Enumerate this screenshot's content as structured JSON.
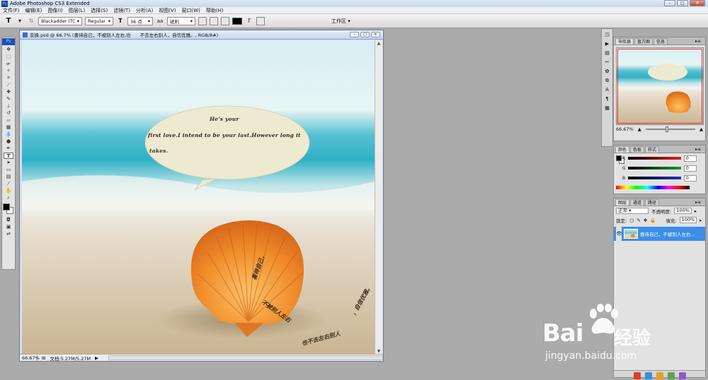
{
  "app": {
    "title": "Adobe Photoshop CS3 Extended",
    "logo": "Ps"
  },
  "menu": [
    "文件(F)",
    "编辑(E)",
    "图像(I)",
    "图层(L)",
    "选择(S)",
    "滤镜(T)",
    "分析(A)",
    "视图(V)",
    "窗口(W)",
    "帮助(H)"
  ],
  "options": {
    "tool_icon": "T",
    "font_family": "Blackadder ITC",
    "font_style": "Regular",
    "font_size": "36 点",
    "antialias": "锐利",
    "workspace": "工作区"
  },
  "document": {
    "title": "变换.psd @ 66.7% (喜待自己，不被别人左右,也　　不去左右别人，自信优雅。, RGB/8#)",
    "zoom": "66.67%",
    "doc_size": "文档:5.27M/5.27M",
    "bubble_lines": [
      "He's your",
      "first love.I intend to be your last.However long it",
      "takes."
    ]
  },
  "navigator": {
    "tabs": [
      "导航器",
      "直方图",
      "信息"
    ],
    "zoom": "66.67%"
  },
  "color_panel": {
    "tabs": [
      "颜色",
      "色板",
      "样式"
    ],
    "channels": [
      {
        "label": "R",
        "value": "0",
        "color": "#e02020"
      },
      {
        "label": "G",
        "value": "0",
        "color": "#1a9a2a"
      },
      {
        "label": "B",
        "value": "0",
        "color": "#2030c8"
      }
    ]
  },
  "layers_panel": {
    "tabs": [
      "图层",
      "通道",
      "路径"
    ],
    "blend_mode": "正常",
    "opacity_label": "不透明度:",
    "opacity": "100%",
    "lock_label": "锁定:",
    "fill_label": "填充:",
    "fill": "100%",
    "layer_name": "喜待自己，不被别人左右..."
  },
  "watermark": {
    "brand": "Bai",
    "brand2": "经验",
    "url": "jingyan.baidu.com"
  }
}
